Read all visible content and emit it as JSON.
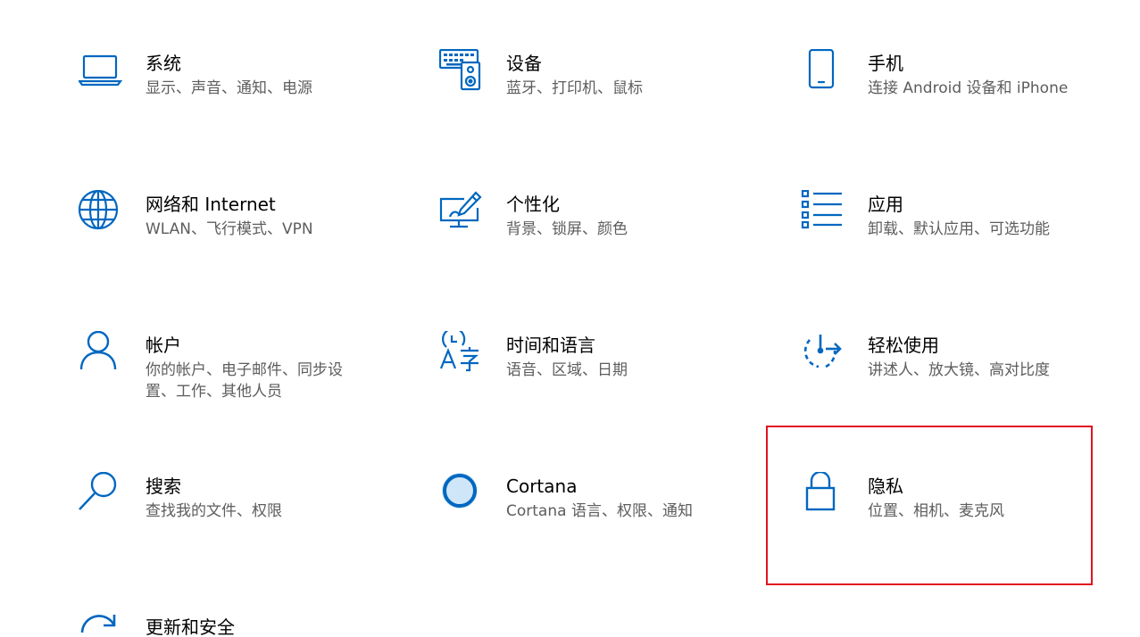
{
  "accent_color": "#0067c0",
  "highlight_color": "#e0141e",
  "settings": [
    {
      "id": "system",
      "icon": "laptop-icon",
      "title": "系统",
      "desc": "显示、声音、通知、电源"
    },
    {
      "id": "devices",
      "icon": "keyboard-speaker-icon",
      "title": "设备",
      "desc": "蓝牙、打印机、鼠标"
    },
    {
      "id": "phone",
      "icon": "phone-icon",
      "title": "手机",
      "desc": "连接 Android 设备和 iPhone"
    },
    {
      "id": "network",
      "icon": "globe-icon",
      "title": "网络和 Internet",
      "desc": "WLAN、飞行模式、VPN"
    },
    {
      "id": "personalization",
      "icon": "monitor-pen-icon",
      "title": "个性化",
      "desc": "背景、锁屏、颜色"
    },
    {
      "id": "apps",
      "icon": "apps-list-icon",
      "title": "应用",
      "desc": "卸载、默认应用、可选功能"
    },
    {
      "id": "accounts",
      "icon": "person-icon",
      "title": "帐户",
      "desc": "你的帐户、电子邮件、同步设置、工作、其他人员"
    },
    {
      "id": "time-language",
      "icon": "time-language-icon",
      "title": "时间和语言",
      "desc": "语音、区域、日期"
    },
    {
      "id": "ease-of-access",
      "icon": "ease-of-access-icon",
      "title": "轻松使用",
      "desc": "讲述人、放大镜、高对比度"
    },
    {
      "id": "search",
      "icon": "search-icon",
      "title": "搜索",
      "desc": "查找我的文件、权限"
    },
    {
      "id": "cortana",
      "icon": "cortana-ring-icon",
      "title": "Cortana",
      "desc": "Cortana 语言、权限、通知"
    },
    {
      "id": "privacy",
      "icon": "lock-icon",
      "title": "隐私",
      "desc": "位置、相机、麦克风"
    },
    {
      "id": "update-security",
      "icon": "refresh-icon",
      "title": "更新和安全",
      "desc": ""
    }
  ]
}
